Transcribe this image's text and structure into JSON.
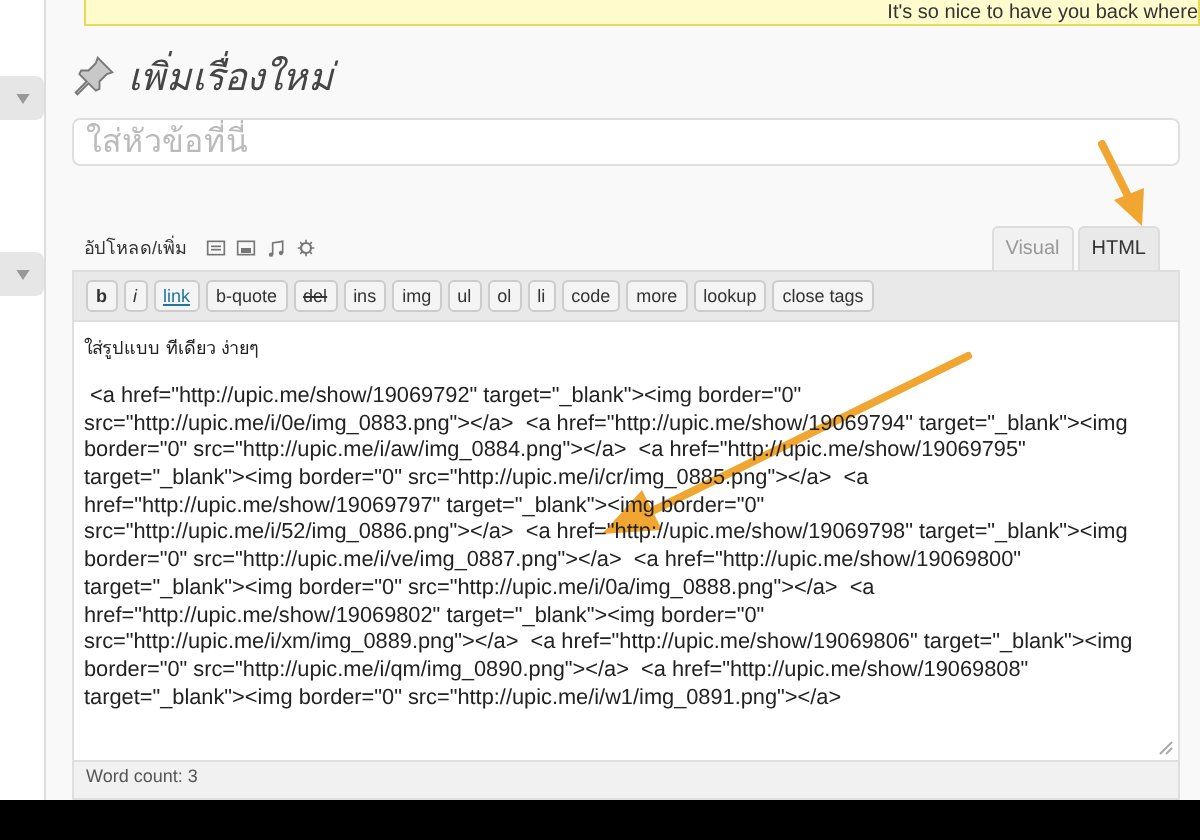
{
  "notice": {
    "text": "It's so nice to have you back where"
  },
  "page_title": "เพิ่มเรื่องใหม่",
  "title_field": {
    "placeholder": "ใส่หัวข้อที่นี่"
  },
  "upload": {
    "label": "อัปโหลด/เพิ่ม"
  },
  "tabs": [
    {
      "label": "Visual",
      "selected": false
    },
    {
      "label": "HTML",
      "selected": true
    }
  ],
  "toolbar": [
    {
      "label": "b",
      "kind": "bold"
    },
    {
      "label": "i",
      "kind": "italic"
    },
    {
      "label": "link",
      "kind": "link"
    },
    {
      "label": "b-quote",
      "kind": "plain"
    },
    {
      "label": "del",
      "kind": "strike"
    },
    {
      "label": "ins",
      "kind": "plain"
    },
    {
      "label": "img",
      "kind": "plain"
    },
    {
      "label": "ul",
      "kind": "plain"
    },
    {
      "label": "ol",
      "kind": "plain"
    },
    {
      "label": "li",
      "kind": "plain"
    },
    {
      "label": "code",
      "kind": "plain"
    },
    {
      "label": "more",
      "kind": "plain"
    },
    {
      "label": "lookup",
      "kind": "plain"
    },
    {
      "label": "close tags",
      "kind": "plain"
    }
  ],
  "editor": {
    "heading": "ใส่รูปแบบ ทีเดียว ง่ายๆ",
    "lines": [
      " <a href=\"http://upic.me/show/19069792\" target=\"_blank\"><img border=\"0\"",
      "src=\"http://upic.me/i/0e/img_0883.png\"></a>  <a href=\"http://upic.me/show/19069794\" target=\"_blank\"><img",
      "border=\"0\" src=\"http://upic.me/i/aw/img_0884.png\"></a>  <a href=\"http://upic.me/show/19069795\"",
      "target=\"_blank\"><img border=\"0\" src=\"http://upic.me/i/cr/img_0885.png\"></a>  <a",
      "href=\"http://upic.me/show/19069797\" target=\"_blank\"><img border=\"0\"",
      "src=\"http://upic.me/i/52/img_0886.png\"></a>  <a href=\"http://upic.me/show/19069798\" target=\"_blank\"><img",
      "border=\"0\" src=\"http://upic.me/i/ve/img_0887.png\"></a>  <a href=\"http://upic.me/show/19069800\"",
      "target=\"_blank\"><img border=\"0\" src=\"http://upic.me/i/0a/img_0888.png\"></a>  <a",
      "href=\"http://upic.me/show/19069802\" target=\"_blank\"><img border=\"0\"",
      "src=\"http://upic.me/i/xm/img_0889.png\"></a>  <a href=\"http://upic.me/show/19069806\" target=\"_blank\"><img",
      "border=\"0\" src=\"http://upic.me/i/qm/img_0890.png\"></a>  <a href=\"http://upic.me/show/19069808\"",
      "target=\"_blank\"><img border=\"0\" src=\"http://upic.me/i/w1/img_0891.png\"></a>"
    ]
  },
  "word_count": "Word count: 3"
}
